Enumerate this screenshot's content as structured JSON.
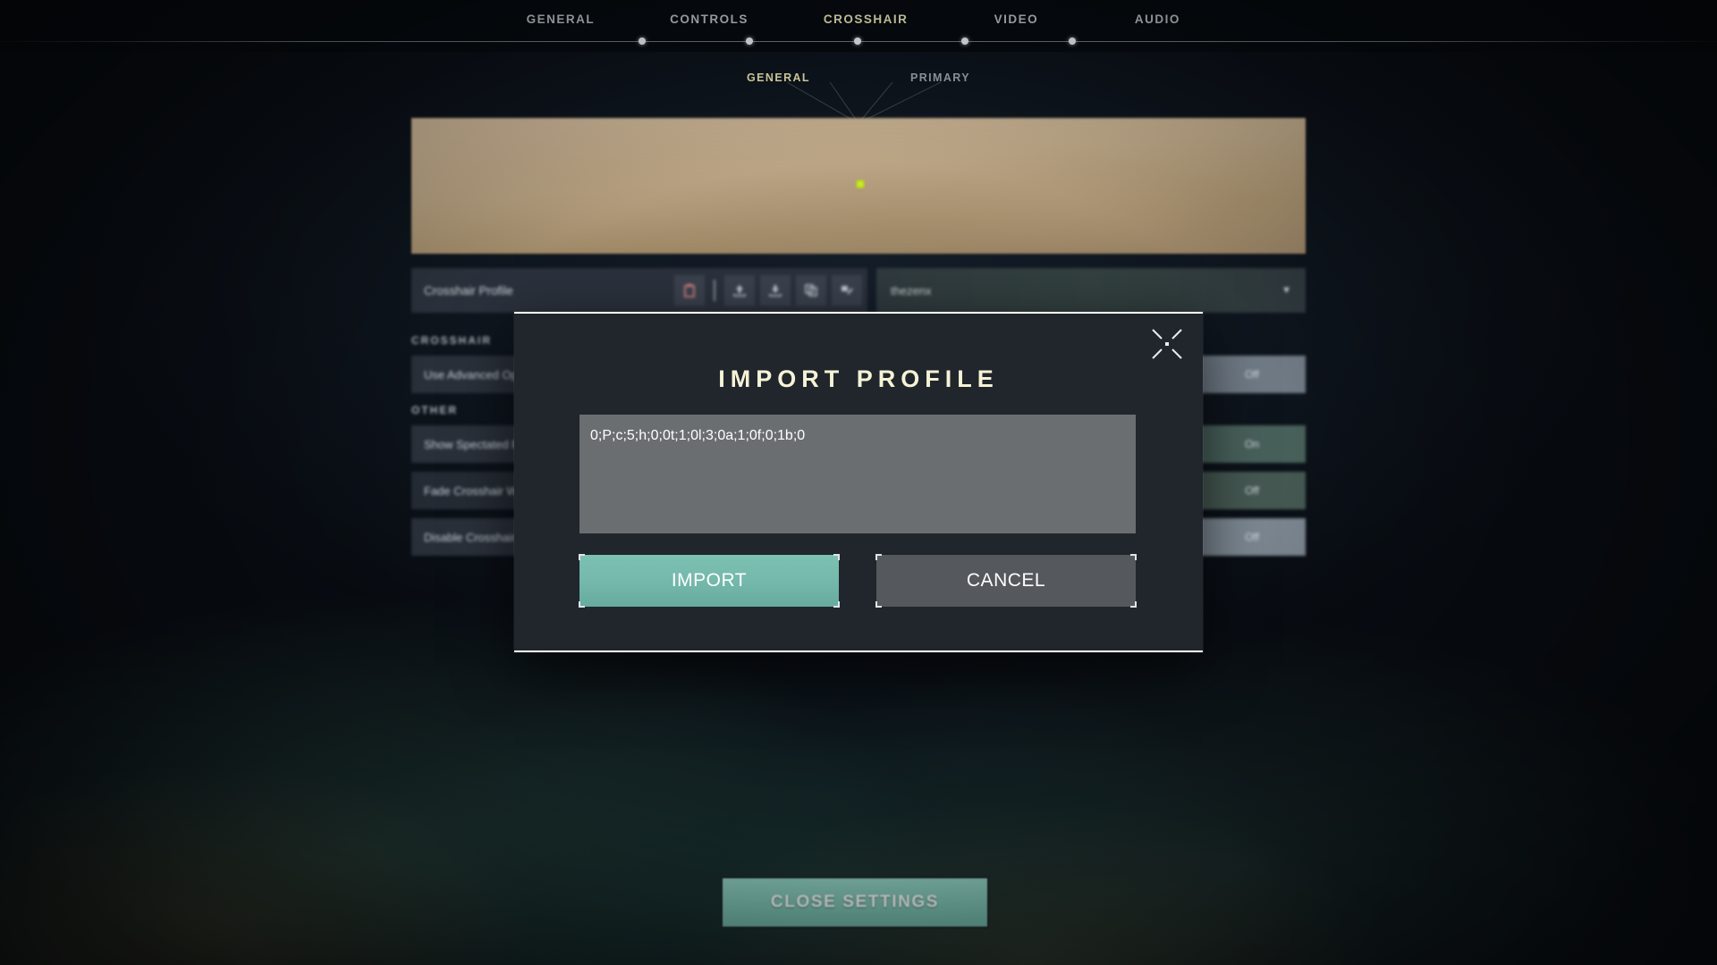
{
  "topnav": {
    "tabs": [
      {
        "label": "GENERAL",
        "active": false
      },
      {
        "label": "CONTROLS",
        "active": false
      },
      {
        "label": "CROSSHAIR",
        "active": true
      },
      {
        "label": "VIDEO",
        "active": false
      },
      {
        "label": "AUDIO",
        "active": false
      }
    ]
  },
  "subnav": {
    "tabs": [
      {
        "label": "GENERAL",
        "active": true
      },
      {
        "label": "PRIMARY",
        "active": false
      }
    ]
  },
  "preview": {
    "crosshair_color": "#c8e020"
  },
  "profile_row": {
    "label": "Crosshair Profile",
    "icons": [
      {
        "name": "delete-profile-icon",
        "glyph": "⬛"
      },
      {
        "name": "import-profile-icon",
        "glyph": "⬆"
      },
      {
        "name": "export-profile-icon",
        "glyph": "⬇"
      },
      {
        "name": "duplicate-profile-icon",
        "glyph": "⧉"
      },
      {
        "name": "rename-profile-icon",
        "glyph": "✎"
      }
    ],
    "selected_profile": "thezenx",
    "caret": "▼"
  },
  "sections": [
    {
      "title": "CROSSHAIR",
      "rows": [
        {
          "label": "Use Advanced Options",
          "value": "Off"
        }
      ]
    },
    {
      "title": "OTHER",
      "rows": [
        {
          "label": "Show Spectated Player's Crosshair",
          "value": "On"
        },
        {
          "label": "Fade Crosshair With Firing Error",
          "value": "Off"
        },
        {
          "label": "Disable Crosshair Center Dot",
          "value": "Off"
        }
      ]
    }
  ],
  "close_settings": {
    "label": "CLOSE SETTINGS"
  },
  "modal": {
    "title": "IMPORT PROFILE",
    "close_icon": "crosshair-close-icon",
    "input_value": "0;P;c;5;h;0;0t;1;0l;3;0a;1;0f;0;1b;0",
    "input_placeholder": "",
    "confirm_label": "IMPORT",
    "cancel_label": "CANCEL"
  },
  "colors": {
    "accent_teal": "#7cc0b2",
    "accent_gold": "#e8e4b8",
    "title_cream": "#f6f2d6",
    "modal_bg": "#20262c",
    "input_bg": "#6b6e71",
    "cancel_bg": "#55585c"
  }
}
